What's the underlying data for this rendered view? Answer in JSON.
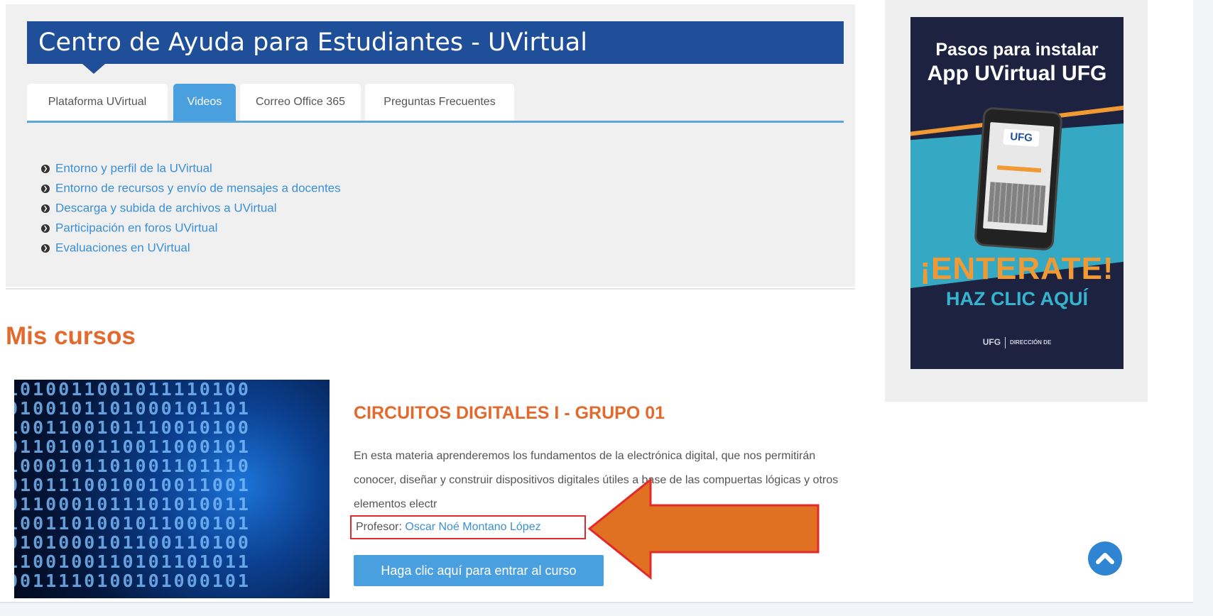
{
  "help_center": {
    "title": "Centro de Ayuda para Estudiantes - UVirtual",
    "tabs": [
      {
        "label": "Plataforma UVirtual",
        "active": false
      },
      {
        "label": "Videos",
        "active": true
      },
      {
        "label": "Correo Office 365",
        "active": false
      },
      {
        "label": "Preguntas Frecuentes",
        "active": false
      }
    ],
    "links": [
      "Entorno y perfil de la UVirtual",
      "Entorno de recursos y envío de mensajes a docentes",
      "Descarga y subida de archivos a UVirtual",
      "Participación en foros UVirtual",
      "Evaluaciones en UVirtual"
    ]
  },
  "courses_section": {
    "title": "Mis cursos",
    "course": {
      "title": "CIRCUITOS DIGITALES I - GRUPO 01",
      "description": "En esta materia aprenderemos los fundamentos de la electrónica digital, que nos permitirán conocer, diseñar y construir dispositivos digitales útiles a base de las compuertas lógicas y otros elementos electr",
      "professor_label": "Profesor:",
      "professor_name": "Oscar Noé Montano López",
      "enter_button": "Haga clic aquí para entrar al curso"
    }
  },
  "promo": {
    "heading_line1": "Pasos para instalar",
    "heading_line2": "App UVirtual UFG",
    "phone_logo": "UFG",
    "cta": "¡ENTERATE!",
    "cta_sub": "HAZ CLIC AQUÍ",
    "footer_brand": "UFG",
    "footer_org": "DIRECCIÓN DE"
  },
  "colors": {
    "header_blue": "#1e4f98",
    "accent_blue": "#4a9fde",
    "orange": "#e36a2e",
    "annotation_red": "#e12a2a",
    "annotation_arrow": "#e07022"
  },
  "icons": {
    "link_bullet": "chevron-circle-right-icon",
    "scroll_top": "chevron-up-circle-icon"
  }
}
